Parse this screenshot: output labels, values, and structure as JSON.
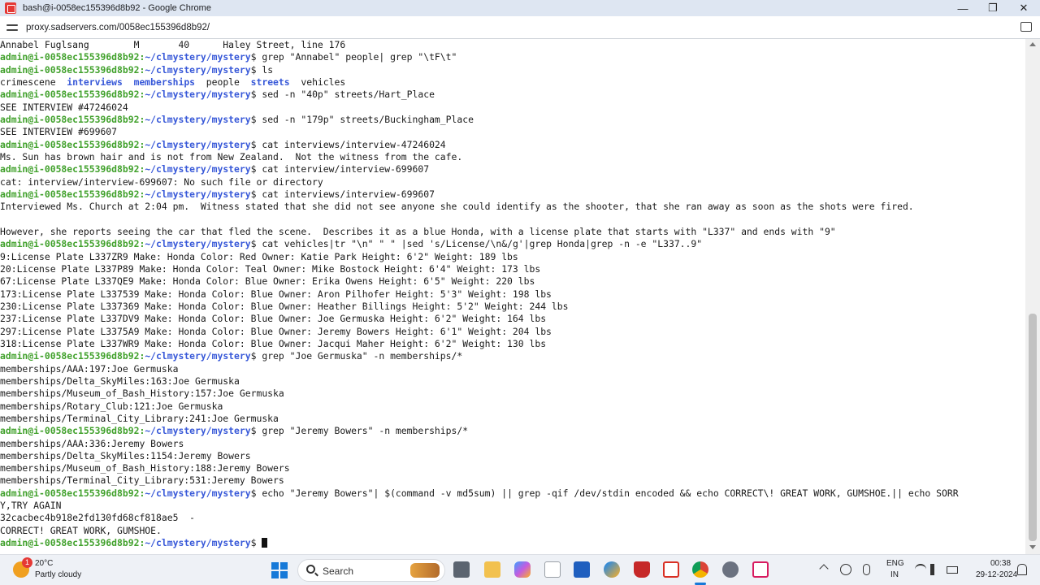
{
  "window": {
    "title": "bash@i-0058ec155396d8b92 - Google Chrome",
    "min_label": "—",
    "max_label": "❐",
    "close_label": "✕"
  },
  "address": {
    "url": "proxy.sadservers.com/0058ec155396d8b92/"
  },
  "terminal": {
    "prompt_user": "admin@i-0058ec155396d8b92:",
    "prompt_path": "~/clmystery/mystery",
    "prompt_symbol": "$ ",
    "lines": [
      {
        "type": "out",
        "text": "Annabel Fuglsang        M       40      Haley Street, line 176"
      },
      {
        "type": "cmd",
        "text": "grep \"Annabel\" people| grep \"\\tF\\t\""
      },
      {
        "type": "cmd",
        "text": "ls"
      },
      {
        "type": "ls",
        "items": [
          {
            "text": "crimescene",
            "dir": false
          },
          {
            "text": "interviews",
            "dir": true
          },
          {
            "text": "memberships",
            "dir": true
          },
          {
            "text": "people",
            "dir": false
          },
          {
            "text": "streets",
            "dir": true
          },
          {
            "text": "vehicles",
            "dir": false
          }
        ]
      },
      {
        "type": "cmd",
        "text": "sed -n \"40p\" streets/Hart_Place"
      },
      {
        "type": "out",
        "text": "SEE INTERVIEW #47246024"
      },
      {
        "type": "cmd",
        "text": "sed -n \"179p\" streets/Buckingham_Place"
      },
      {
        "type": "out",
        "text": "SEE INTERVIEW #699607"
      },
      {
        "type": "cmd",
        "text": "cat interviews/interview-47246024"
      },
      {
        "type": "out",
        "text": "Ms. Sun has brown hair and is not from New Zealand.  Not the witness from the cafe."
      },
      {
        "type": "cmd",
        "text": "cat interview/interview-699607"
      },
      {
        "type": "out",
        "text": "cat: interview/interview-699607: No such file or directory"
      },
      {
        "type": "cmd",
        "text": "cat interviews/interview-699607"
      },
      {
        "type": "out",
        "text": "Interviewed Ms. Church at 2:04 pm.  Witness stated that she did not see anyone she could identify as the shooter, that she ran away as soon as the shots were fired."
      },
      {
        "type": "out",
        "text": ""
      },
      {
        "type": "out",
        "text": "However, she reports seeing the car that fled the scene.  Describes it as a blue Honda, with a license plate that starts with \"L337\" and ends with \"9\""
      },
      {
        "type": "cmd",
        "text": "cat vehicles|tr \"\\n\" \" \" |sed 's/License/\\n&/g'|grep Honda|grep -n -e \"L337..9\""
      },
      {
        "type": "out",
        "text": "9:License Plate L337ZR9 Make: Honda Color: Red Owner: Katie Park Height: 6'2\" Weight: 189 lbs"
      },
      {
        "type": "out",
        "text": "20:License Plate L337P89 Make: Honda Color: Teal Owner: Mike Bostock Height: 6'4\" Weight: 173 lbs"
      },
      {
        "type": "out",
        "text": "67:License Plate L337QE9 Make: Honda Color: Blue Owner: Erika Owens Height: 6'5\" Weight: 220 lbs"
      },
      {
        "type": "out",
        "text": "173:License Plate L337539 Make: Honda Color: Blue Owner: Aron Pilhofer Height: 5'3\" Weight: 198 lbs"
      },
      {
        "type": "out",
        "text": "230:License Plate L337369 Make: Honda Color: Blue Owner: Heather Billings Height: 5'2\" Weight: 244 lbs"
      },
      {
        "type": "out",
        "text": "237:License Plate L337DV9 Make: Honda Color: Blue Owner: Joe Germuska Height: 6'2\" Weight: 164 lbs"
      },
      {
        "type": "out",
        "text": "297:License Plate L3375A9 Make: Honda Color: Blue Owner: Jeremy Bowers Height: 6'1\" Weight: 204 lbs"
      },
      {
        "type": "out",
        "text": "318:License Plate L337WR9 Make: Honda Color: Blue Owner: Jacqui Maher Height: 6'2\" Weight: 130 lbs"
      },
      {
        "type": "cmd",
        "text": "grep \"Joe Germuska\" -n memberships/*"
      },
      {
        "type": "out",
        "text": "memberships/AAA:197:Joe Germuska"
      },
      {
        "type": "out",
        "text": "memberships/Delta_SkyMiles:163:Joe Germuska"
      },
      {
        "type": "out",
        "text": "memberships/Museum_of_Bash_History:157:Joe Germuska"
      },
      {
        "type": "out",
        "text": "memberships/Rotary_Club:121:Joe Germuska"
      },
      {
        "type": "out",
        "text": "memberships/Terminal_City_Library:241:Joe Germuska"
      },
      {
        "type": "cmd",
        "text": "grep \"Jeremy Bowers\" -n memberships/*"
      },
      {
        "type": "out",
        "text": "memberships/AAA:336:Jeremy Bowers"
      },
      {
        "type": "out",
        "text": "memberships/Delta_SkyMiles:1154:Jeremy Bowers"
      },
      {
        "type": "out",
        "text": "memberships/Museum_of_Bash_History:188:Jeremy Bowers"
      },
      {
        "type": "out",
        "text": "memberships/Terminal_City_Library:531:Jeremy Bowers"
      },
      {
        "type": "cmd",
        "text": "echo \"Jeremy Bowers\"| $(command -v md5sum) || grep -qif /dev/stdin encoded && echo CORRECT\\! GREAT WORK, GUMSHOE.|| echo SORR"
      },
      {
        "type": "out",
        "text": "Y,TRY AGAIN"
      },
      {
        "type": "out",
        "text": "32cacbec4b918e2fd130fd68cf818ae5  -"
      },
      {
        "type": "out",
        "text": "CORRECT! GREAT WORK, GUMSHOE."
      },
      {
        "type": "cursor",
        "text": ""
      }
    ]
  },
  "taskbar": {
    "weather_badge": "1",
    "weather_temp": "20°C",
    "weather_desc": "Partly cloudy",
    "search_label": "Search",
    "lang_top": "ENG",
    "lang_bottom": "IN",
    "clock_time": "00:38",
    "clock_date": "29-12-2024"
  },
  "colors": {
    "prompt_user": "#41a12c",
    "prompt_path": "#3758d8",
    "directory": "#3758d8",
    "accent": "#1679d8"
  }
}
